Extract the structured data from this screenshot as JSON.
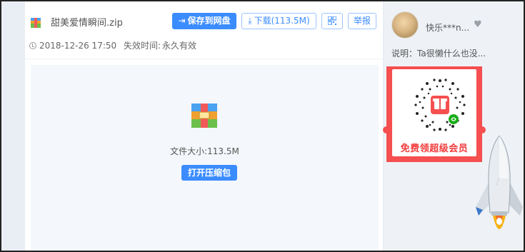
{
  "file": {
    "name": "甜美爱情瞬间.zip",
    "icon": "zip-archive-icon"
  },
  "toolbar": {
    "save_label": "保存到网盘",
    "download_label": "下载(113.5M)",
    "qr_icon": "qr-code-icon",
    "report_label": "举报"
  },
  "meta": {
    "date": "2018-12-26 17:50",
    "expire_label": "失效时间:",
    "expire_value": "永久有效"
  },
  "preview": {
    "size_text": "文件大小:113.5M",
    "open_label": "打开压缩包"
  },
  "sidebar": {
    "username": "快乐***n...",
    "description": "说明：Ta很懒什么也没...",
    "promo_text": "免费领超级会员"
  },
  "colors": {
    "accent": "#3b8cff",
    "promo_red": "#f54f4f"
  }
}
